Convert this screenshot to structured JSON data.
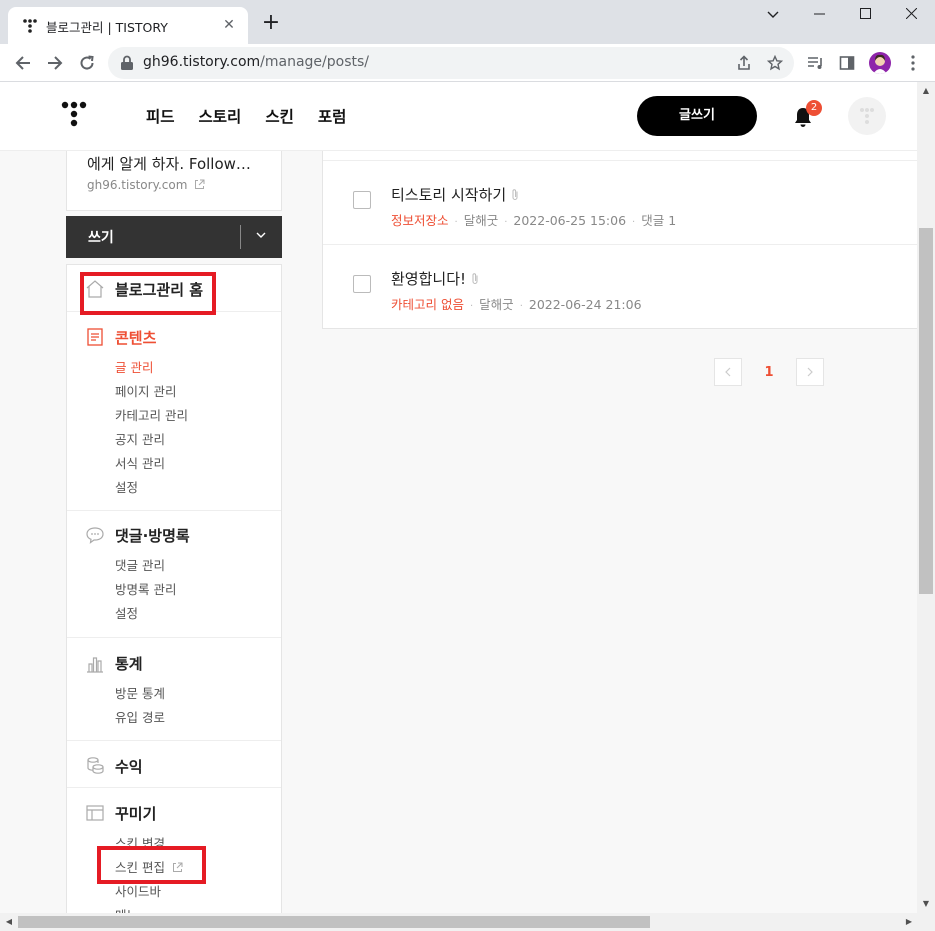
{
  "browser": {
    "tab_title": "블로그관리 | TISTORY",
    "tab_close": "✕",
    "new_tab": "+",
    "url_host": "gh96.tistory.com",
    "url_path": "/manage/posts/"
  },
  "header": {
    "nav": [
      "피드",
      "스토리",
      "스킨",
      "포럼"
    ],
    "write_button": "글쓰기",
    "notification_count": "2"
  },
  "sidebar": {
    "blog_description": "에게 알게 하자. Follow…",
    "blog_url": "gh96.tistory.com",
    "write_label": "쓰기",
    "home_label": "블로그관리 홈",
    "sections": {
      "contents": {
        "label": "콘텐츠",
        "items": [
          "글 관리",
          "페이지 관리",
          "카테고리 관리",
          "공지 관리",
          "서식 관리",
          "설정"
        ]
      },
      "comments": {
        "label": "댓글·방명록",
        "items": [
          "댓글 관리",
          "방명록 관리",
          "설정"
        ]
      },
      "stats": {
        "label": "통계",
        "items": [
          "방문 통계",
          "유입 경로"
        ]
      },
      "revenue": {
        "label": "수익"
      },
      "design": {
        "label": "꾸미기",
        "items": [
          "스킨 변경",
          "스킨 편집",
          "사이드바",
          "메뉴"
        ]
      }
    }
  },
  "posts": [
    {
      "title": "티스토리 시작하기",
      "category": "정보저장소",
      "author": "달해굿",
      "date": "2022-06-25 15:06",
      "comments": "댓글 1"
    },
    {
      "title": "환영합니다!",
      "category": "카테고리 없음",
      "author": "달해굿",
      "date": "2022-06-24 21:06",
      "comments": ""
    }
  ],
  "pagination": {
    "current_page": "1"
  },
  "colors": {
    "accent": "#ee4f34",
    "highlight_box": "#e51b24",
    "write_bar": "#333333"
  }
}
